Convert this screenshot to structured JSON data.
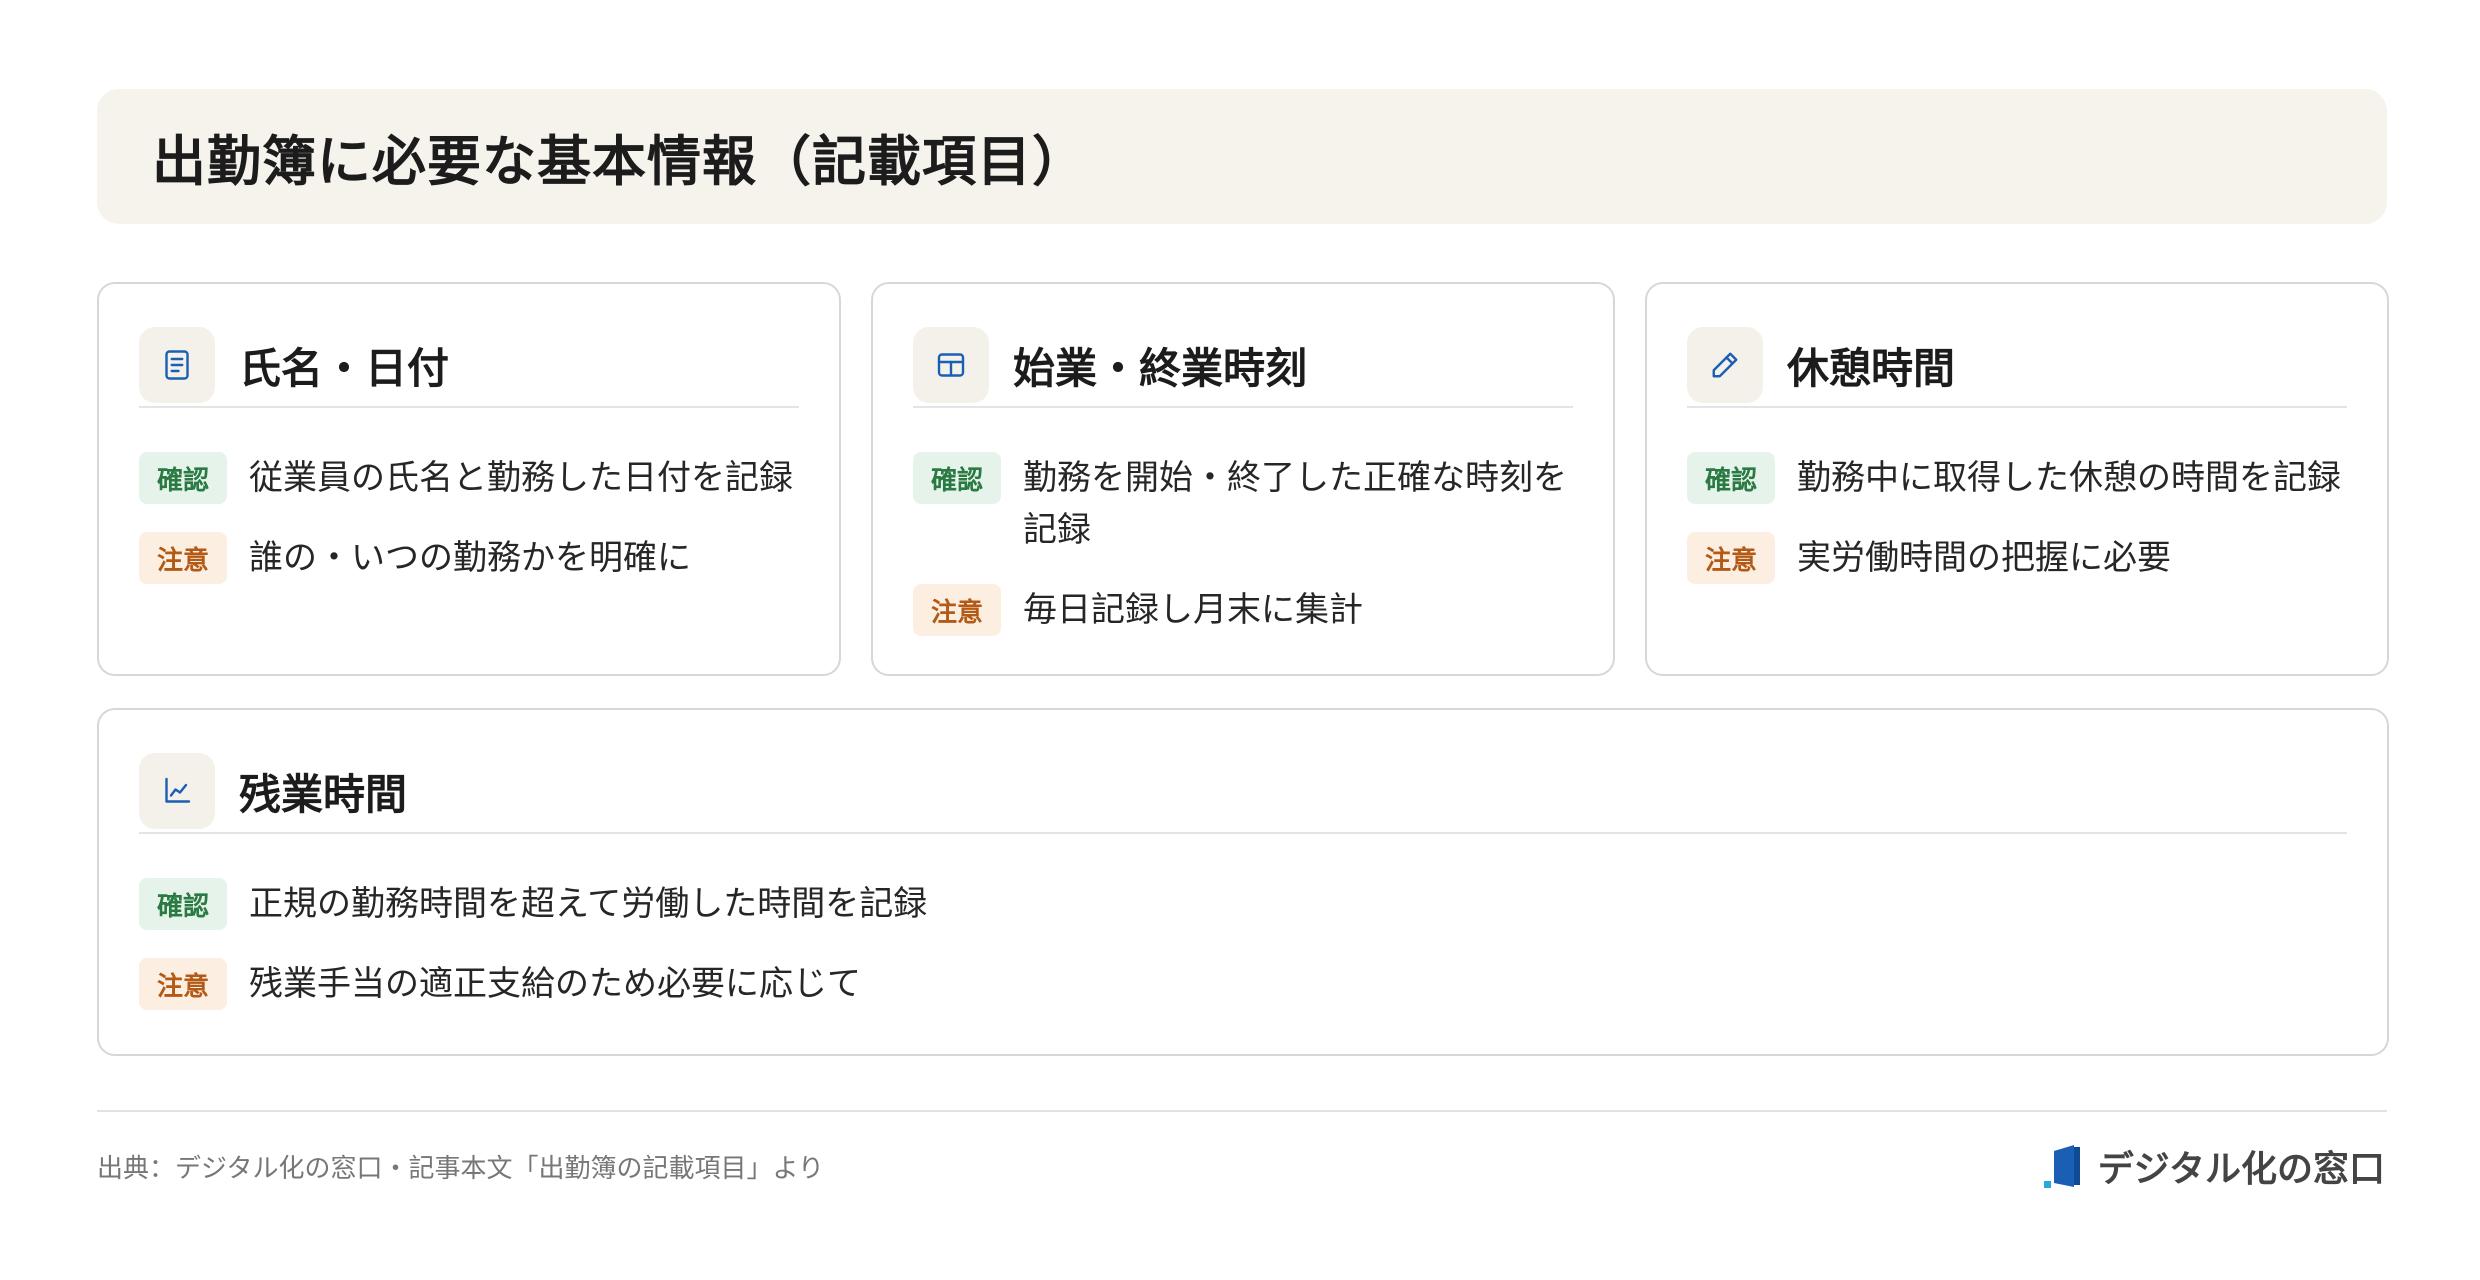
{
  "title": "出勤簿に必要な基本情報（記載項目）",
  "cards": [
    {
      "title": "氏名・日付",
      "icon": "document-icon",
      "rows": [
        {
          "badge": "確認",
          "text": "従業員の氏名と勤務した日付を記録"
        },
        {
          "badge": "注意",
          "text": "誰の・いつの勤務かを明確に"
        }
      ]
    },
    {
      "title": "始業・終業時刻",
      "icon": "table-icon",
      "rows": [
        {
          "badge": "確認",
          "text": "勤務を開始・終了した正確な時刻を記録"
        },
        {
          "badge": "注意",
          "text": "毎日記録し月末に集計"
        }
      ]
    },
    {
      "title": "休憩時間",
      "icon": "pencil-icon",
      "rows": [
        {
          "badge": "確認",
          "text": "勤務中に取得した休憩の時間を記録"
        },
        {
          "badge": "注意",
          "text": "実労働時間の把握に必要"
        }
      ]
    },
    {
      "title": "残業時間",
      "icon": "line-chart-icon",
      "rows": [
        {
          "badge": "確認",
          "text": "正規の勤務時間を超えて労働した時間を記録"
        },
        {
          "badge": "注意",
          "text": "残業手当の適正支給のため必要に応じて"
        }
      ]
    }
  ],
  "footer": {
    "source": "出典：デジタル化の窓口・記事本文「出勤簿の記載項目」より",
    "logo_text": "デジタル化の窓口"
  },
  "colors": {
    "accent_blue": "#1a5fb4",
    "badge_ok": "#2a7a43",
    "badge_warn": "#b25a16",
    "title_bg": "#f6f3ec"
  }
}
